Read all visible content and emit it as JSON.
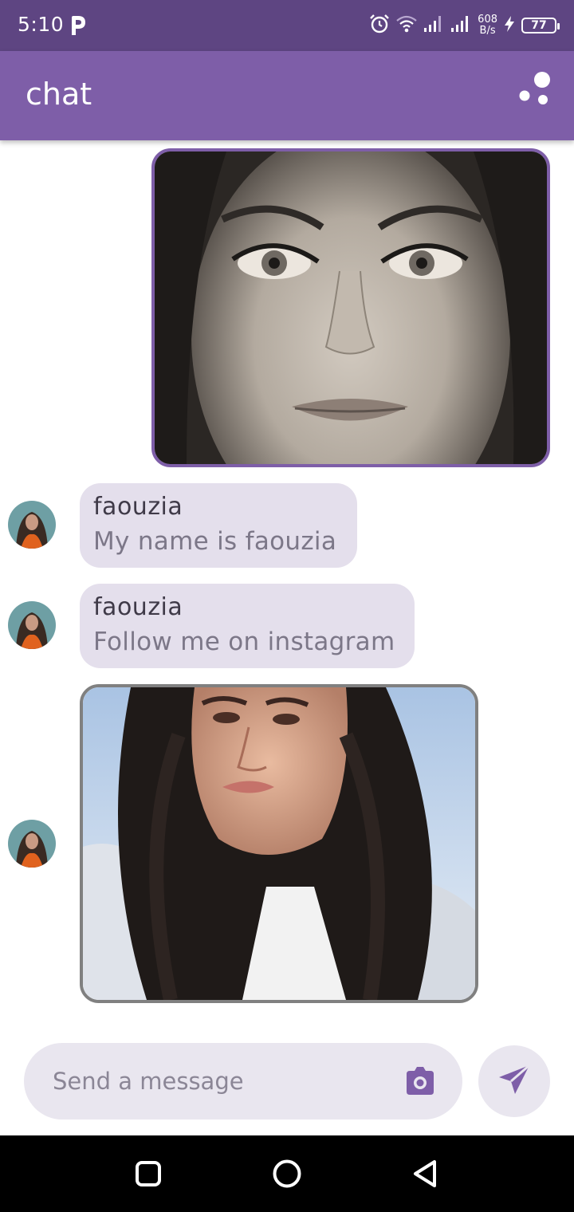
{
  "status_bar": {
    "time": "5:10",
    "net_speed_value": "608",
    "net_speed_unit": "B/s",
    "battery": "77",
    "icons": [
      "pinterest-p-icon",
      "alarm-icon",
      "wifi-icon",
      "signal-icon",
      "signal-icon",
      "charging-icon",
      "battery-icon"
    ]
  },
  "app_bar": {
    "title": "chat",
    "menu_icon": "three-dots-icon"
  },
  "messages": [
    {
      "type": "image",
      "direction": "sent",
      "description_icon": "photo"
    },
    {
      "type": "text",
      "direction": "received",
      "sender": "faouzia",
      "text": "My name is faouzia"
    },
    {
      "type": "text",
      "direction": "received",
      "sender": "faouzia",
      "text": "Follow me on instagram"
    },
    {
      "type": "image",
      "direction": "received",
      "description_icon": "photo"
    }
  ],
  "composer": {
    "placeholder": "Send a message",
    "camera_icon": "camera-icon",
    "send_icon": "send-icon"
  },
  "nav_bar": {
    "icons": [
      "recents-icon",
      "home-icon",
      "back-icon"
    ]
  },
  "colors": {
    "status_bar": "#5e4582",
    "primary": "#7e5ea8",
    "bubble": "#e4dfec",
    "input_bg": "#e9e6ef"
  }
}
